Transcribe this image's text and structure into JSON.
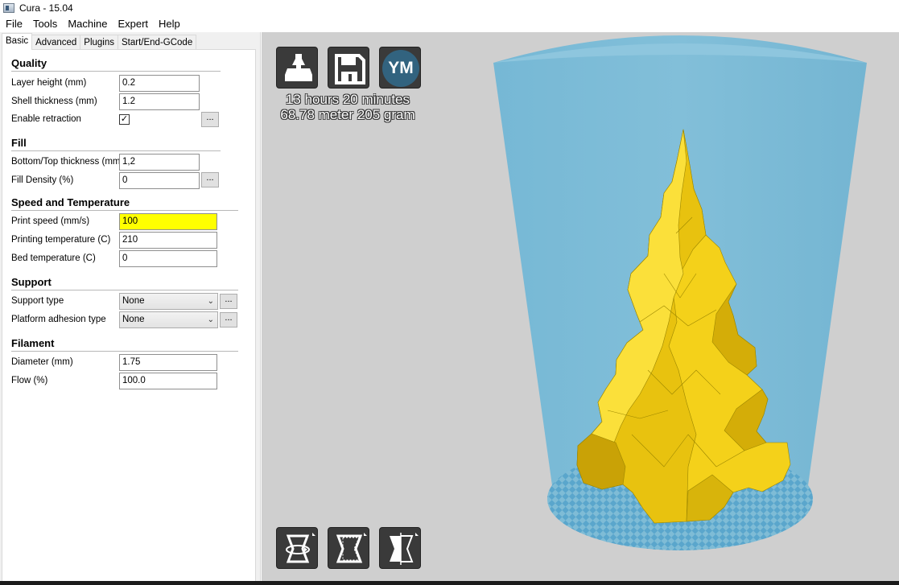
{
  "window": {
    "title": "Cura - 15.04"
  },
  "menu": [
    "File",
    "Tools",
    "Machine",
    "Expert",
    "Help"
  ],
  "tabs": [
    "Basic",
    "Advanced",
    "Plugins",
    "Start/End-GCode"
  ],
  "sections": {
    "quality": {
      "title": "Quality",
      "layer_height_label": "Layer height (mm)",
      "layer_height_value": "0.2",
      "shell_thickness_label": "Shell thickness (mm)",
      "shell_thickness_value": "1.2",
      "enable_retraction_label": "Enable retraction",
      "enable_retraction_checked": "✓"
    },
    "fill": {
      "title": "Fill",
      "bottom_top_label": "Bottom/Top thickness (mm)",
      "bottom_top_value": "1,2",
      "fill_density_label": "Fill Density (%)",
      "fill_density_value": "0"
    },
    "speed": {
      "title": "Speed and Temperature",
      "print_speed_label": "Print speed (mm/s)",
      "print_speed_value": "100",
      "print_temp_label": "Printing temperature (C)",
      "print_temp_value": "210",
      "bed_temp_label": "Bed temperature (C)",
      "bed_temp_value": "0"
    },
    "support": {
      "title": "Support",
      "support_type_label": "Support type",
      "support_type_value": "None",
      "adhesion_label": "Platform adhesion type",
      "adhesion_value": "None"
    },
    "filament": {
      "title": "Filament",
      "diameter_label": "Diameter (mm)",
      "diameter_value": "1.75",
      "flow_label": "Flow (%)",
      "flow_value": "100.0"
    }
  },
  "dots_label": "...",
  "viewport": {
    "print_time": "13 hours 20 minutes",
    "print_material": "68.78 meter 205 gram",
    "ym_label": "YM",
    "top_icons": [
      "load-model-icon",
      "save-toolpath-icon",
      "youmagine-icon"
    ],
    "bottom_icons": [
      "rotate-icon",
      "scale-icon",
      "mirror-icon"
    ]
  },
  "colors": {
    "viewport_bg": "#cfcfcf",
    "build_volume": "#7fbcd6",
    "model": "#f6d51c",
    "field_highlight": "#ffff00"
  }
}
